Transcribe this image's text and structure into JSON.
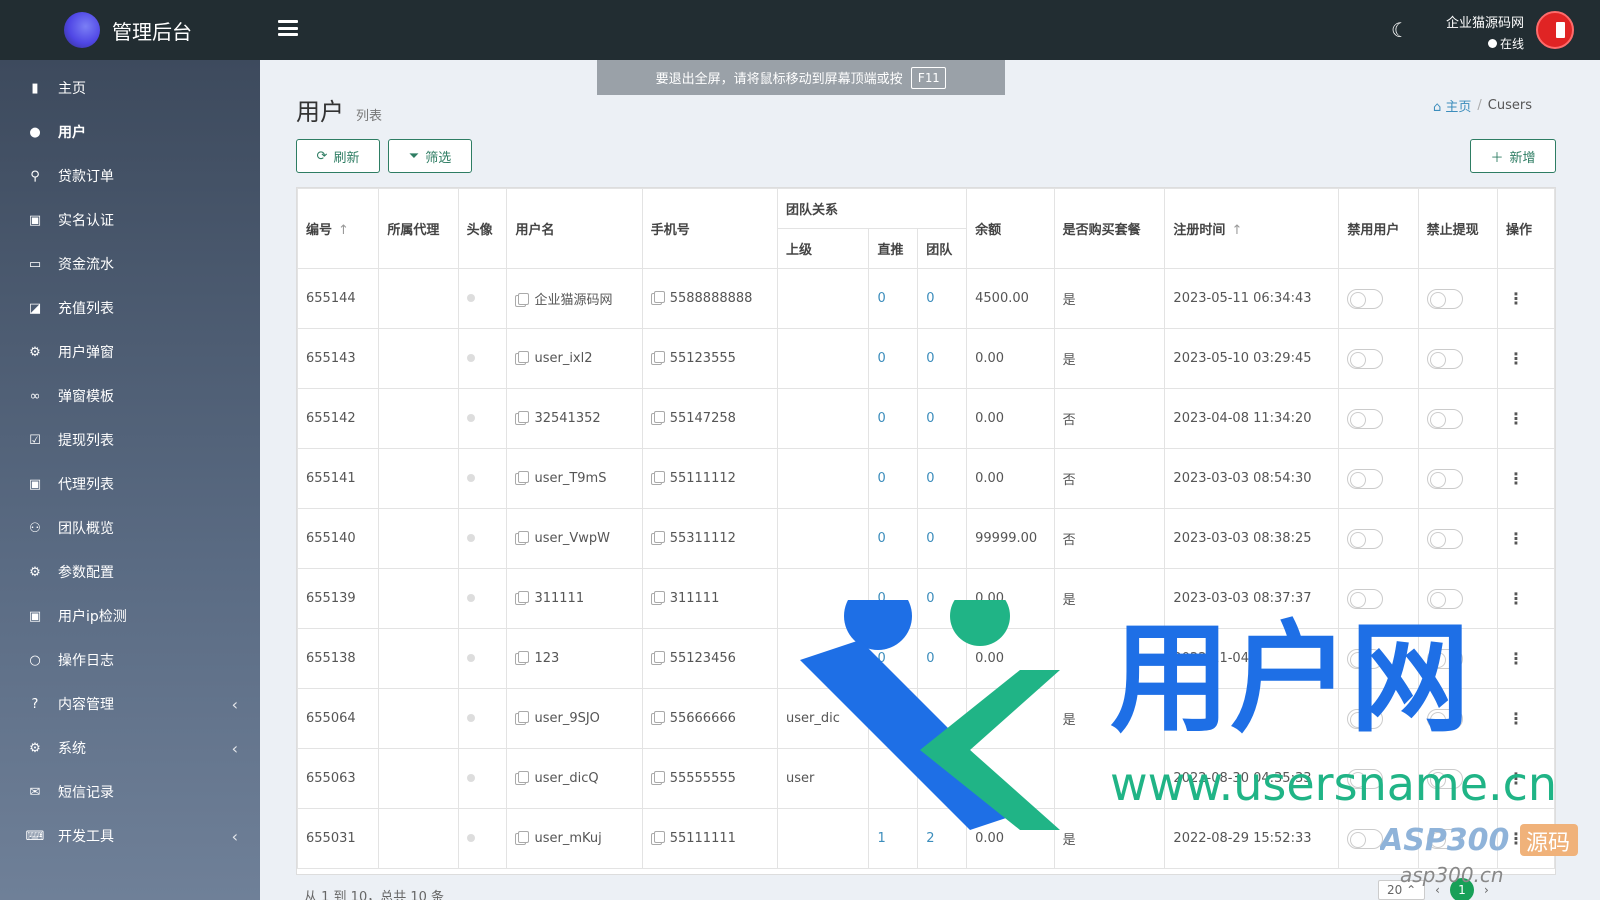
{
  "header": {
    "app_title": "管理后台",
    "user_name": "企业猫源码网",
    "user_status": "在线"
  },
  "sidebar": {
    "items": [
      {
        "label": "主页",
        "icon": "bar-chart-icon"
      },
      {
        "label": "用户",
        "icon": "user-icon"
      },
      {
        "label": "贷款订单",
        "icon": "motorcycle-icon"
      },
      {
        "label": "实名认证",
        "icon": "id-card-icon"
      },
      {
        "label": "资金流水",
        "icon": "money-icon"
      },
      {
        "label": "充值列表",
        "icon": "recharge-icon"
      },
      {
        "label": "用户弹窗",
        "icon": "popup-icon"
      },
      {
        "label": "弹窗模板",
        "icon": "link-icon"
      },
      {
        "label": "提现列表",
        "icon": "check-square-icon"
      },
      {
        "label": "代理列表",
        "icon": "agent-icon"
      },
      {
        "label": "团队概览",
        "icon": "team-icon"
      },
      {
        "label": "参数配置",
        "icon": "cogs-icon"
      },
      {
        "label": "用户ip检测",
        "icon": "ip-icon"
      },
      {
        "label": "操作日志",
        "icon": "circle-icon"
      },
      {
        "label": "内容管理",
        "icon": "question-icon"
      },
      {
        "label": "系统",
        "icon": "gear-icon"
      },
      {
        "label": "短信记录",
        "icon": "comment-icon"
      },
      {
        "label": "开发工具",
        "icon": "keyboard-icon"
      }
    ]
  },
  "banner": {
    "text": "要退出全屏，请将鼠标移动到屏幕顶端或按",
    "key": "F11"
  },
  "page": {
    "title": "用户",
    "subtitle": "列表"
  },
  "breadcrumb": {
    "home": "主页",
    "current": "Cusers"
  },
  "toolbar": {
    "refresh": "刷新",
    "filter": "筛选",
    "add": "新增"
  },
  "table": {
    "headers": {
      "id": "编号",
      "agent": "所属代理",
      "avatar": "头像",
      "username": "用户名",
      "phone": "手机号",
      "team": "团队关系",
      "parent": "上级",
      "direct": "直推",
      "team_count": "团队",
      "balance": "余额",
      "package": "是否购买套餐",
      "reg_time": "注册时间",
      "ban_user": "禁用用户",
      "ban_withdraw": "禁止提现",
      "actions": "操作"
    },
    "rows": [
      {
        "id": "655144",
        "agent": "",
        "username": "企业猫源码网",
        "phone": "5588888888",
        "parent": "",
        "direct": "0",
        "team": "0",
        "balance": "4500.00",
        "package": "是",
        "reg_time": "2023-05-11 06:34:43"
      },
      {
        "id": "655143",
        "agent": "",
        "username": "user_ixl2",
        "phone": "55123555",
        "parent": "",
        "direct": "0",
        "team": "0",
        "balance": "0.00",
        "package": "是",
        "reg_time": "2023-05-10 03:29:45"
      },
      {
        "id": "655142",
        "agent": "",
        "username": "32541352",
        "phone": "55147258",
        "parent": "",
        "direct": "0",
        "team": "0",
        "balance": "0.00",
        "package": "否",
        "reg_time": "2023-04-08 11:34:20"
      },
      {
        "id": "655141",
        "agent": "",
        "username": "user_T9mS",
        "phone": "55111112",
        "parent": "",
        "direct": "0",
        "team": "0",
        "balance": "0.00",
        "package": "否",
        "reg_time": "2023-03-03 08:54:30"
      },
      {
        "id": "655140",
        "agent": "",
        "username": "user_VwpW",
        "phone": "55311112",
        "parent": "",
        "direct": "0",
        "team": "0",
        "balance": "99999.00",
        "package": "否",
        "reg_time": "2023-03-03 08:38:25"
      },
      {
        "id": "655139",
        "agent": "",
        "username": "311111",
        "phone": "311111",
        "parent": "",
        "direct": "0",
        "team": "0",
        "balance": "0.00",
        "package": "是",
        "reg_time": "2023-03-03 08:37:37"
      },
      {
        "id": "655138",
        "agent": "",
        "username": "123",
        "phone": "55123456",
        "parent": "",
        "direct": "0",
        "team": "0",
        "balance": "0.00",
        "package": "",
        "reg_time": "2022-11-04"
      },
      {
        "id": "655064",
        "agent": "",
        "username": "user_9SJO",
        "phone": "55666666",
        "parent": "user_dic",
        "direct": "",
        "team": "",
        "balance": "",
        "package": "是",
        "reg_time": ""
      },
      {
        "id": "655063",
        "agent": "",
        "username": "user_dicQ",
        "phone": "55555555",
        "parent": "user",
        "direct": "",
        "team": "",
        "balance": "",
        "package": "",
        "reg_time": "2022-08-30 04:35:33"
      },
      {
        "id": "655031",
        "agent": "",
        "username": "user_mKuj",
        "phone": "55111111",
        "parent": "",
        "direct": "1",
        "team": "2",
        "balance": "0.00",
        "package": "是",
        "reg_time": "2022-08-29 15:52:33"
      }
    ]
  },
  "footer": {
    "info": "从 1 到 10，总共 10 条",
    "page_size": "20",
    "current_page": "1"
  },
  "watermark": {
    "brand": "用户网",
    "url": "www.usersname.cn",
    "brand2": "ASP300",
    "brand2_suffix": "源码",
    "url2": "asp300.cn"
  }
}
